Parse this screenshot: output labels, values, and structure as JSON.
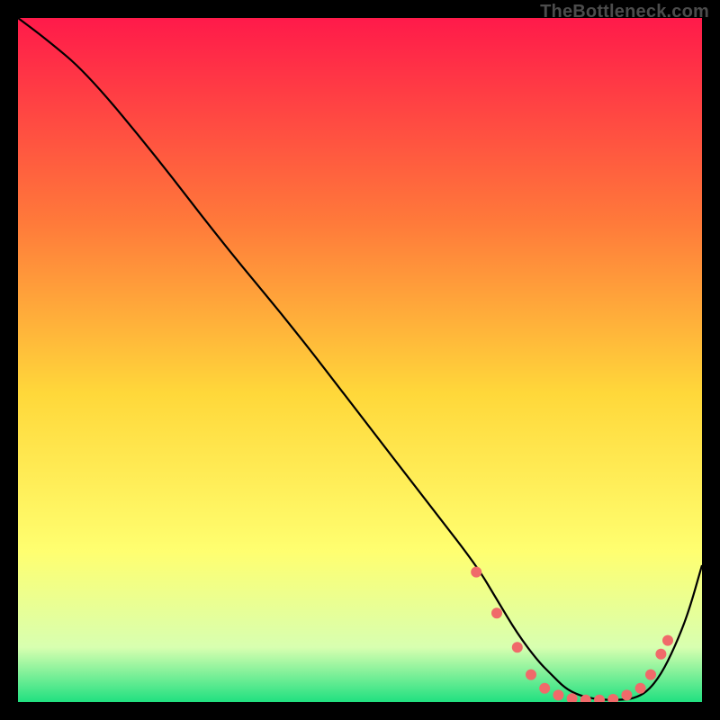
{
  "attribution": "TheBottleneck.com",
  "colors": {
    "gradient_top": "#ff1a4a",
    "gradient_mid1": "#ff7a3a",
    "gradient_mid2": "#ffd83a",
    "gradient_mid3": "#ffff70",
    "gradient_mid4": "#d8ffb0",
    "gradient_bottom": "#20e080",
    "curve": "#000000",
    "dots": "#f06a6a",
    "frame": "#000000"
  },
  "chart_data": {
    "type": "line",
    "title": "",
    "xlabel": "",
    "ylabel": "",
    "xlim": [
      0,
      100
    ],
    "ylim": [
      0,
      100
    ],
    "series": [
      {
        "name": "curve",
        "x": [
          0,
          4,
          10,
          20,
          30,
          40,
          50,
          60,
          67,
          70,
          73,
          76,
          78,
          80,
          82,
          84,
          86,
          88,
          90,
          92,
          94,
          96,
          98,
          100
        ],
        "y": [
          100,
          97,
          92,
          80,
          67,
          55,
          42,
          29,
          20,
          15,
          10,
          6,
          4,
          2,
          1,
          0.5,
          0.3,
          0.3,
          0.5,
          1.5,
          4,
          8,
          13,
          20
        ]
      }
    ],
    "dots": {
      "name": "markers",
      "points": [
        {
          "x": 67,
          "y": 19
        },
        {
          "x": 70,
          "y": 13
        },
        {
          "x": 73,
          "y": 8
        },
        {
          "x": 75,
          "y": 4
        },
        {
          "x": 77,
          "y": 2
        },
        {
          "x": 79,
          "y": 1
        },
        {
          "x": 81,
          "y": 0.5
        },
        {
          "x": 83,
          "y": 0.3
        },
        {
          "x": 85,
          "y": 0.3
        },
        {
          "x": 87,
          "y": 0.4
        },
        {
          "x": 89,
          "y": 1
        },
        {
          "x": 91,
          "y": 2
        },
        {
          "x": 92.5,
          "y": 4
        },
        {
          "x": 94,
          "y": 7
        },
        {
          "x": 95,
          "y": 9
        }
      ]
    }
  }
}
